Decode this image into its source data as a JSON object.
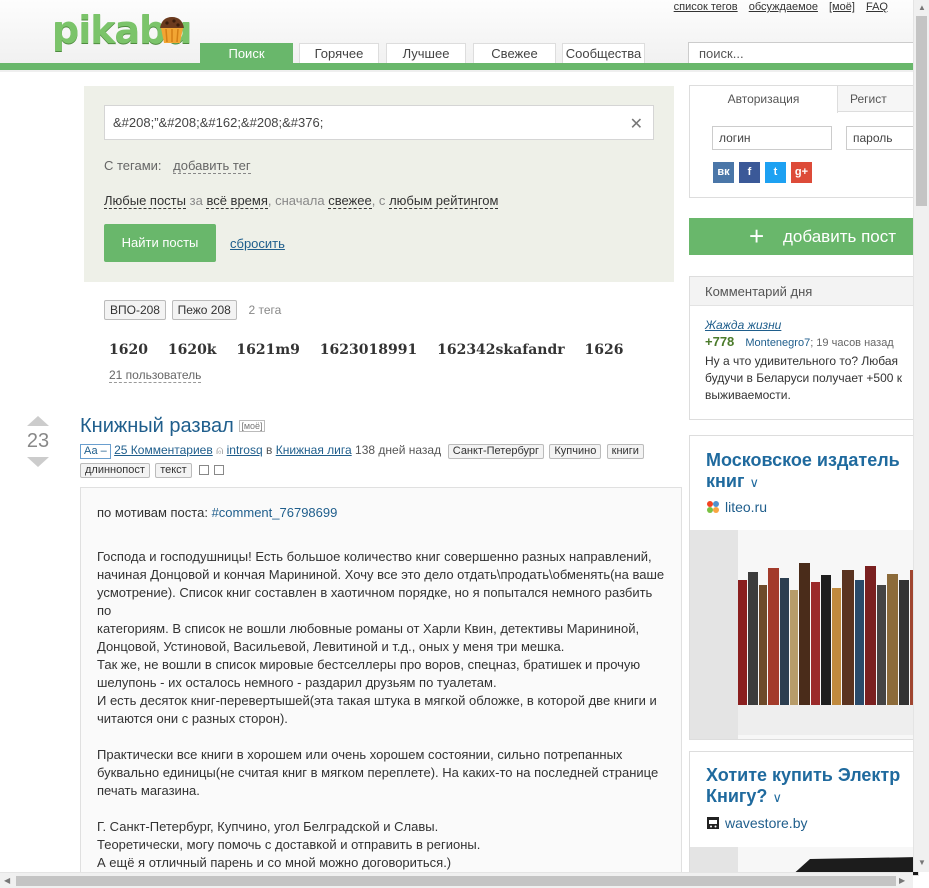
{
  "header": {
    "logo_text": "pikabu",
    "top_links": [
      "список тегов",
      "обсуждаемое",
      "[моё]",
      "FAQ"
    ],
    "tabs": [
      "Поиск",
      "Горячее",
      "Лучшее",
      "Свежее",
      "Сообщества"
    ],
    "active_tab": "Поиск",
    "search_placeholder": "поиск...",
    "accent_color": "#69b76b"
  },
  "search_panel": {
    "query_value": "&#208;”&#208;&#162;&#208;&#376;",
    "tags_label": "С тегами:",
    "add_tag": "добавить тег",
    "filter": {
      "posts": "Любые посты",
      "for": "за",
      "period": "всё время",
      "sort_prefix": ", сначала",
      "sort": "свежее",
      "rating_prefix": ", с",
      "rating": "любым рейтингом"
    },
    "find_button": "Найти посты",
    "reset_link": "сбросить"
  },
  "tag_results": {
    "tags": [
      "ВПО-208",
      "Пежо 208"
    ],
    "tags_count": "2 тега",
    "users": [
      "1620",
      "1620k",
      "1621m9",
      "1623018991",
      "162342skafandr",
      "1626"
    ],
    "users_count": "21 пользователь"
  },
  "post": {
    "rating": "23",
    "title": "Книжный развал",
    "mine_label": "[моё]",
    "font_toggle": "Аа –",
    "comments": "25 Комментариев",
    "author": "introsq",
    "in": "в",
    "community": "Книжная лига",
    "age": "138 дней назад",
    "tags_line1": [
      "Санкт-Петербург",
      "Купчино",
      "книги"
    ],
    "tags_line2": [
      "длиннопост",
      "текст"
    ],
    "body": {
      "ref_prefix": "по мотивам поста:",
      "ref_link": "#comment_76798699",
      "p1": "Господа и господушницы! Есть большое количество книг совершенно разных направлений,\nначиная Донцовой и кончая Марининой. Хочу все это дело отдать\\продать\\обменять(на ваше\nусмотрение). Список книг составлен в хаотичном порядке, но я попытался немного разбить по\nкатегориям. В список не вошли любовные романы от Харли Квин, детективы Марининой,\nДонцовой, Устиновой, Васильевой, Левитиной и т.д., оных у меня три мешка.\nТак же, не вошли в список мировые бестселлеры про воров, спецназ, братишек и прочую\nшелупонь - их осталось немного - раздарил друзьям по туалетам.\nИ есть десяток книг-перевертышей(эта такая штука в мягкой обложке, в которой две книги и\nчитаются они с разных сторон).",
      "p2": "Практически все книги в хорошем или очень хорошем состоянии, сильно потрепанных\nбуквально единицы(не считая книг в мягком переплете). На каких-то на последней странице\nпечать магазина.",
      "p3": "Г. Санкт-Петербург, Купчино, угол Белградской и Славы.\nТеоретически, могу помочь с доставкой и отправить в регионы.\nА ещё я отличный парень и со мной можно договориться.)"
    }
  },
  "sidebar": {
    "auth_tabs": [
      "Авторизация",
      "Регист"
    ],
    "login_placeholder": "логин",
    "password_placeholder": "пароль",
    "social": [
      "вк",
      "f",
      "t",
      "g+"
    ],
    "add_post": "добавить пост",
    "comment_of_day": {
      "heading": "Комментарий дня",
      "post_link": "Жажда жизни",
      "rating": "+778",
      "author": "Montenegro7",
      "time": "; 19 часов назад",
      "text_lines": [
        "Ну а что удивительного то? Любая",
        "будучи в Беларуси получает +500 к",
        "выживаемости."
      ]
    },
    "ads": [
      {
        "title_lines": [
          "Московское издатель",
          "книг"
        ],
        "site": "liteo.ru"
      },
      {
        "title_lines": [
          "Хотите купить Электр",
          "Книгу?"
        ],
        "site": "wavestore.by"
      }
    ]
  }
}
